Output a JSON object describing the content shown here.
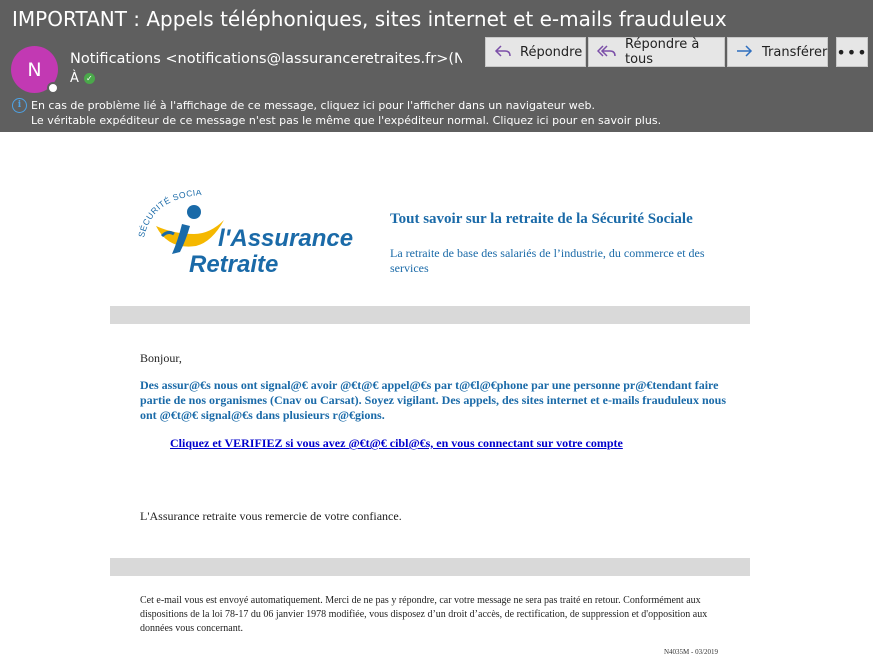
{
  "header": {
    "subject": "IMPORTANT : Appels téléphoniques, sites internet et e-mails frauduleux",
    "avatar_initial": "N",
    "sender": "Notifications <notifications@lassuranceretraites.fr>(Notifications",
    "to_label": "À",
    "actions": {
      "reply": "Répondre",
      "reply_all": "Répondre à tous",
      "forward": "Transférer",
      "more": "•••"
    },
    "info_line1": "En cas de problème lié à l'affichage de ce message, cliquez ici pour l'afficher dans un navigateur web.",
    "info_line2": "Le véritable expéditeur de ce message n'est pas le même que l'expéditeur normal. Cliquez ici pour en savoir plus."
  },
  "logo": {
    "arc_text": "SÉCURITÉ SOCIALE",
    "line1": "l'Assurance",
    "line2": "Retraite"
  },
  "promo": {
    "title": "Tout savoir sur la retraite de la Sécurité Sociale",
    "subtitle": "La retraite de base des salariés de l’industrie, du commerce et des services"
  },
  "message": {
    "greeting": "Bonjour,",
    "warning": "Des assur@€s nous ont signal@€ avoir @€t@€ appel@€s par t@€l@€phone par une personne pr@€tendant faire partie de nos organismes (Cnav ou Carsat). Soyez vigilant. Des appels, des sites internet et e-mails frauduleux nous ont @€t@€ signal@€s dans plusieurs r@€gions.",
    "link_text": "Cliquez et VERIFIEZ si vous avez @€t@€ cibl@€s, en vous connectant sur votre compte",
    "thanks": "L'Assurance retraite vous remercie de votre confiance."
  },
  "footer": {
    "text": "Cet e-mail vous est envoyé automatiquement. Merci de ne pas y répondre, car votre message ne sera pas traité en retour. Conformément aux dispositions de la loi 78-17 du 06 janvier 1978 modifiée, vous disposez d’un droit d’accès, de rectification, de suppression et d'opposition aux données vous concernant.",
    "ref": "N4035M -  03/2019"
  },
  "colors": {
    "header_bg": "#5f5f5f",
    "avatar": "#c239b3",
    "brand_blue": "#1a6aa8",
    "logo_yellow": "#f5b800",
    "link": "#0000cc",
    "bar_grey": "#d9d9d9"
  },
  "icons": {
    "reply": "reply-arrow-icon",
    "reply_all": "reply-all-arrow-icon",
    "forward": "forward-arrow-icon",
    "info": "info-icon",
    "verified": "checkmark-badge-icon"
  }
}
